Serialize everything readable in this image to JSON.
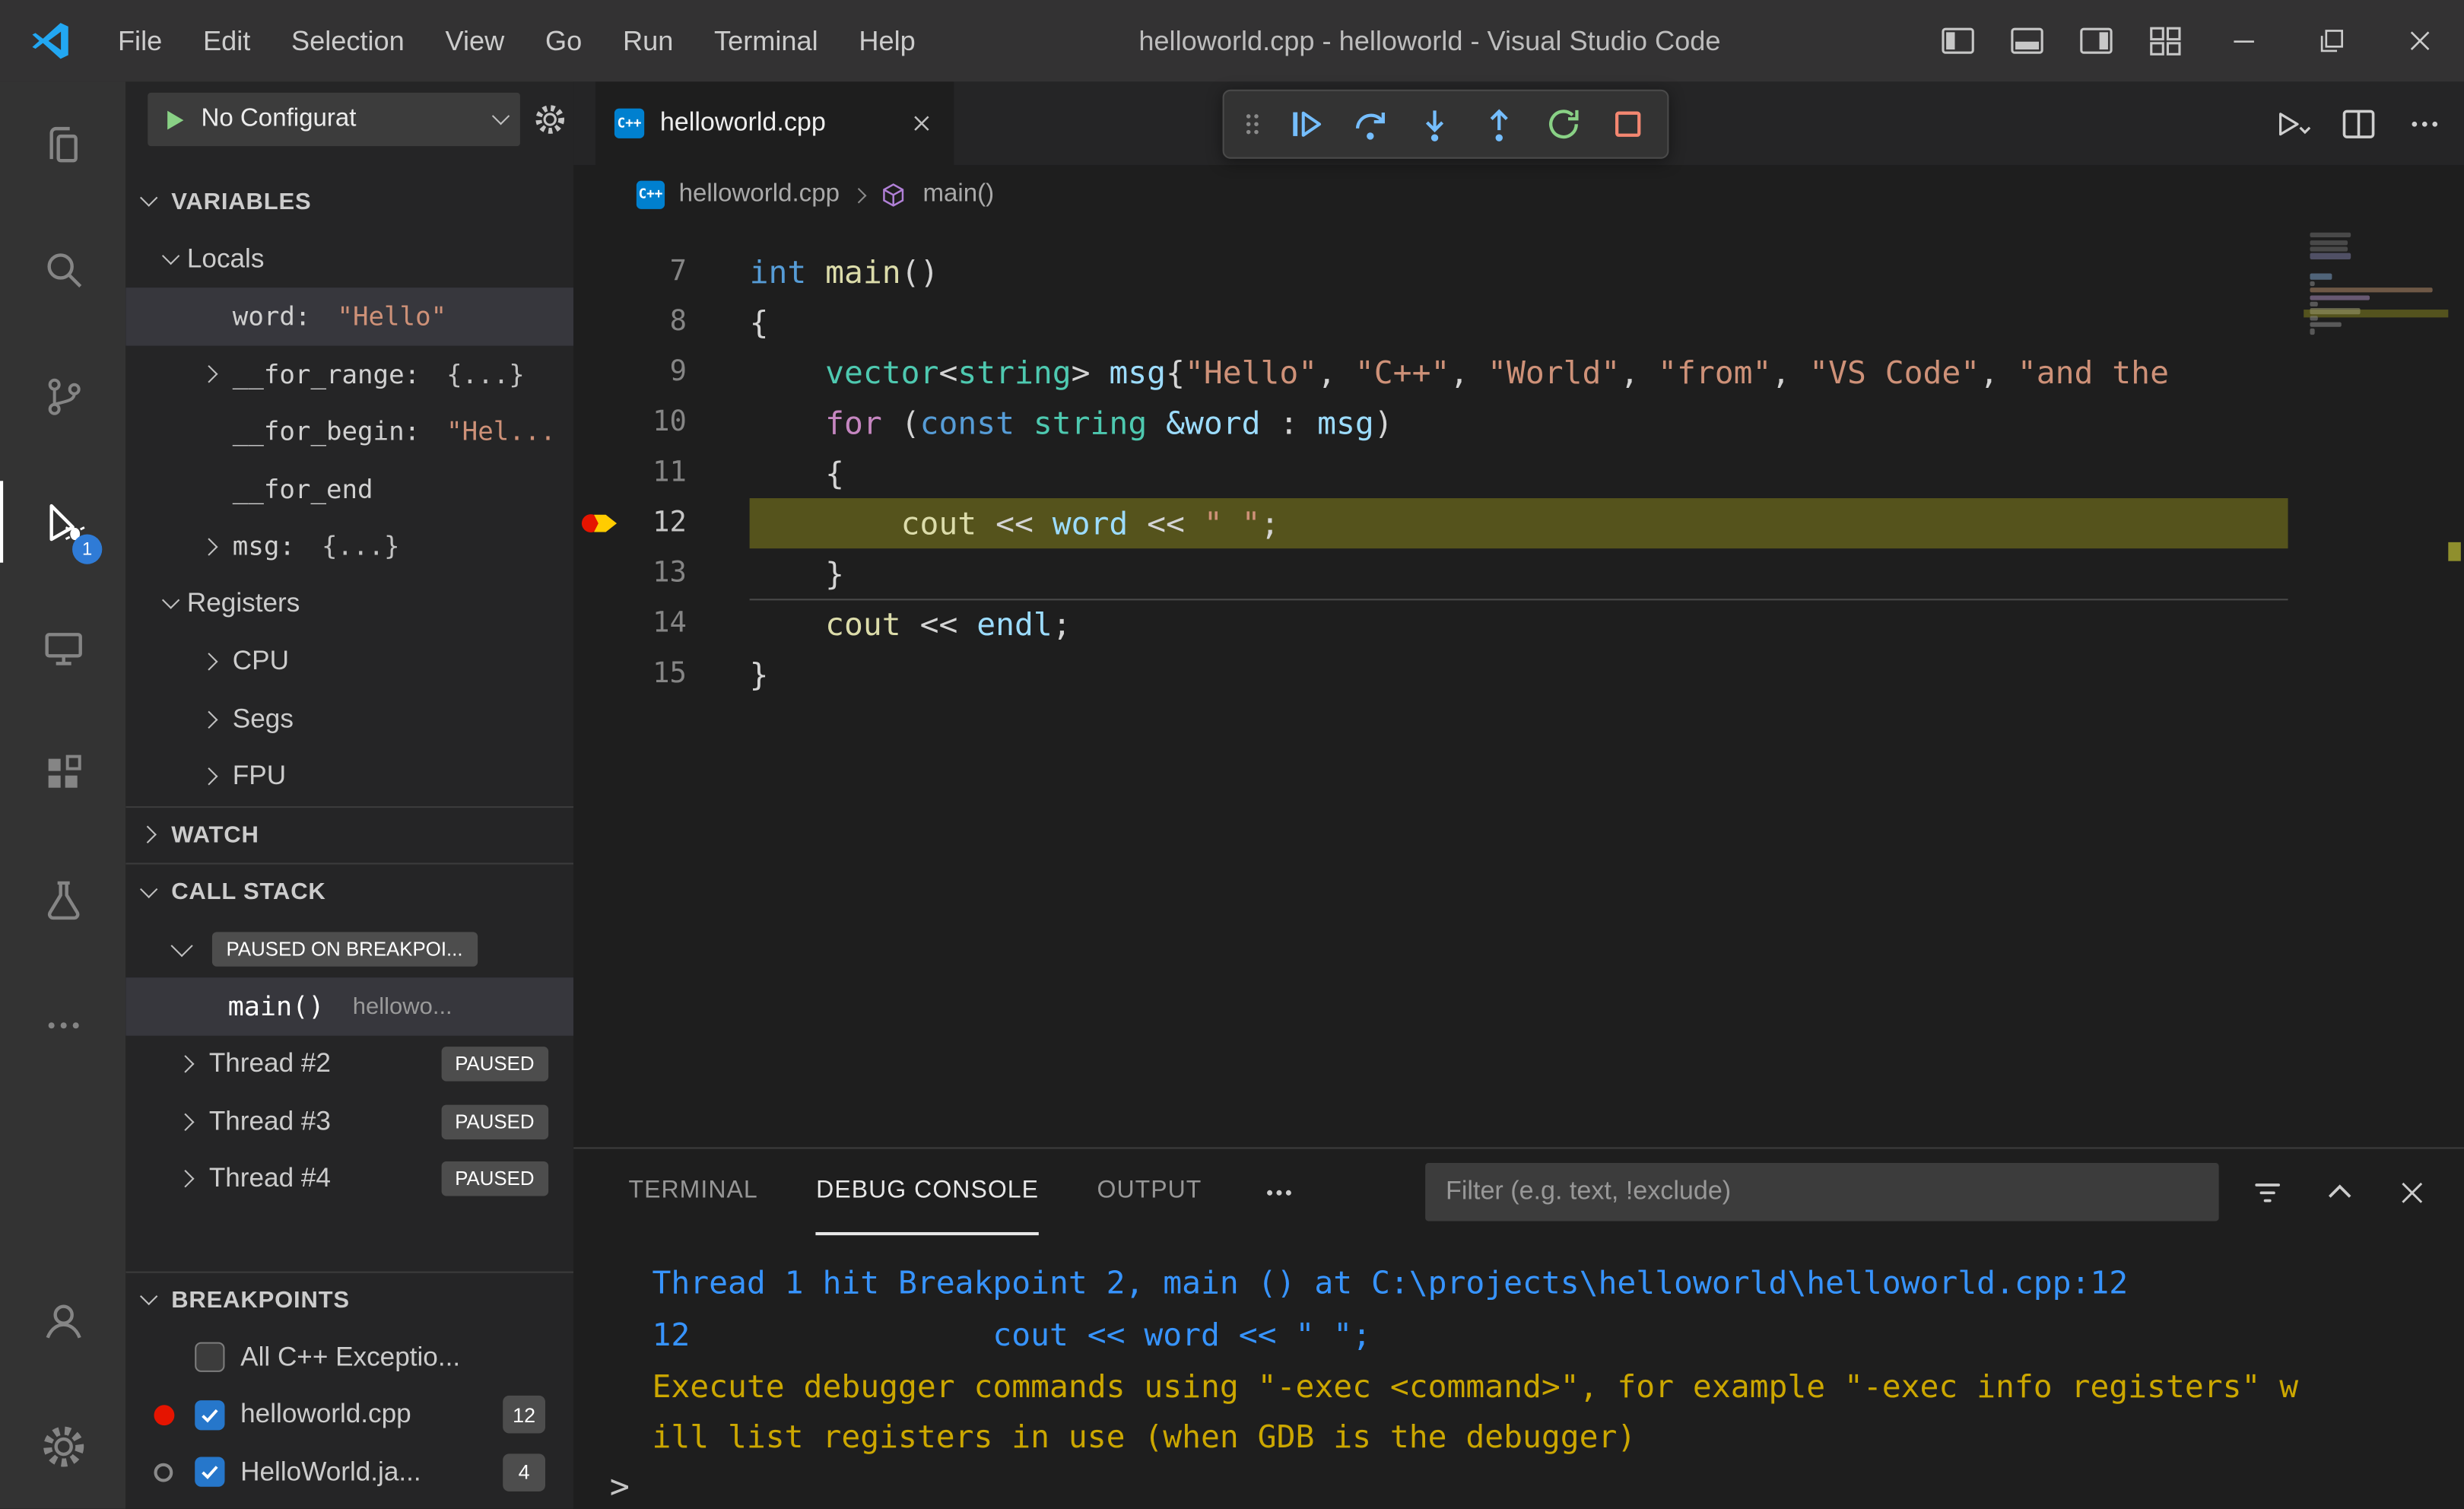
{
  "titlebar": {
    "menus": [
      "File",
      "Edit",
      "Selection",
      "View",
      "Go",
      "Run",
      "Terminal",
      "Help"
    ],
    "title": "helloworld.cpp - helloworld - Visual Studio Code",
    "layout_icons": [
      "layout-sidebar-left",
      "layout-panel",
      "layout-sidebar-right",
      "customize-layout"
    ],
    "window_controls": [
      "minimize",
      "maximize",
      "close"
    ]
  },
  "activitybar": {
    "items": [
      {
        "name": "explorer",
        "icon": "explorer"
      },
      {
        "name": "search",
        "icon": "search"
      },
      {
        "name": "source-control",
        "icon": "scm"
      },
      {
        "name": "run-and-debug",
        "icon": "debug",
        "active": true,
        "badge": "1"
      },
      {
        "name": "remote-explorer",
        "icon": "remote"
      },
      {
        "name": "extensions",
        "icon": "extensions"
      },
      {
        "name": "testing",
        "icon": "testing"
      },
      {
        "name": "more-views",
        "icon": "more"
      }
    ],
    "bottom_items": [
      {
        "name": "account",
        "icon": "account"
      },
      {
        "name": "settings",
        "icon": "gear"
      }
    ]
  },
  "sidebar": {
    "run_toolbar": {
      "config_label": "No Configurat"
    },
    "variables": {
      "header": "VARIABLES",
      "groups": [
        {
          "label": "Locals",
          "items": [
            {
              "name": "word:",
              "value": "\"Hello\"",
              "vtype": "string",
              "chevron": "none",
              "selected": true,
              "mono": true
            },
            {
              "name": "__for_range:",
              "value": "{...}",
              "vtype": "plain",
              "chevron": "right",
              "mono": true
            },
            {
              "name": "__for_begin:",
              "value": "\"Hel...",
              "vtype": "string",
              "chevron": "none",
              "mono": true
            },
            {
              "name": "__for_end",
              "value": "",
              "vtype": "plain",
              "chevron": "none",
              "mono": true
            },
            {
              "name": "msg:",
              "value": "{...}",
              "vtype": "plain",
              "chevron": "right",
              "mono": true
            }
          ]
        },
        {
          "label": "Registers",
          "items": [
            {
              "name": "CPU",
              "value": "",
              "vtype": "plain",
              "chevron": "right",
              "mono": false
            },
            {
              "name": "Segs",
              "value": "",
              "vtype": "plain",
              "chevron": "right",
              "mono": false
            },
            {
              "name": "FPU",
              "value": "",
              "vtype": "plain",
              "chevron": "right",
              "mono": false
            }
          ]
        }
      ]
    },
    "watch": {
      "header": "WATCH"
    },
    "callstack": {
      "header": "CALL STACK",
      "session_status": "PAUSED ON BREAKPOI...",
      "frame": {
        "fn": "main()",
        "file": "hellowo..."
      },
      "threads": [
        {
          "label": "Thread #2",
          "status": "PAUSED"
        },
        {
          "label": "Thread #3",
          "status": "PAUSED"
        },
        {
          "label": "Thread #4",
          "status": "PAUSED"
        }
      ]
    },
    "breakpoints": {
      "header": "BREAKPOINTS",
      "items": [
        {
          "label": "All C++ Exceptio...",
          "checked": false,
          "marker": "none",
          "count": ""
        },
        {
          "label": "helloworld.cpp",
          "checked": true,
          "marker": "red",
          "count": "12"
        },
        {
          "label": "HelloWorld.ja...",
          "checked": true,
          "marker": "gray",
          "count": "4"
        }
      ]
    }
  },
  "editor": {
    "tab": {
      "label": "helloworld.cpp"
    },
    "breadcrumb": {
      "file": "helloworld.cpp",
      "symbol": "main()"
    },
    "debug_toolbar": [
      "continue",
      "step-over",
      "step-into",
      "step-out",
      "restart",
      "stop"
    ],
    "actions": [
      "run-action",
      "split-editor",
      "more"
    ],
    "code": {
      "current_line": "12",
      "lines": [
        {
          "num": "7",
          "tokens": [
            [
              "kw",
              "int"
            ],
            [
              "pl",
              " "
            ],
            [
              "fn",
              "main"
            ],
            [
              "pl",
              "()"
            ]
          ]
        },
        {
          "num": "8",
          "tokens": [
            [
              "pl",
              "{"
            ]
          ]
        },
        {
          "num": "9",
          "tokens": [
            [
              "pl",
              "    "
            ],
            [
              "ty",
              "vector"
            ],
            [
              "pl",
              "<"
            ],
            [
              "ty",
              "string"
            ],
            [
              "pl",
              "> "
            ],
            [
              "va",
              "msg"
            ],
            [
              "pl",
              "{"
            ],
            [
              "st",
              "\"Hello\""
            ],
            [
              "pl",
              ", "
            ],
            [
              "st",
              "\"C++\""
            ],
            [
              "pl",
              ", "
            ],
            [
              "st",
              "\"World\""
            ],
            [
              "pl",
              ", "
            ],
            [
              "st",
              "\"from\""
            ],
            [
              "pl",
              ", "
            ],
            [
              "st",
              "\"VS Code\""
            ],
            [
              "pl",
              ", "
            ],
            [
              "st",
              "\"and the"
            ]
          ]
        },
        {
          "num": "10",
          "tokens": [
            [
              "pl",
              "    "
            ],
            [
              "ct",
              "for"
            ],
            [
              "pl",
              " ("
            ],
            [
              "kw",
              "const"
            ],
            [
              "pl",
              " "
            ],
            [
              "ty",
              "string"
            ],
            [
              "pl",
              " "
            ],
            [
              "va",
              "&word"
            ],
            [
              "pl",
              " : "
            ],
            [
              "va",
              "msg"
            ],
            [
              "pl",
              ")"
            ]
          ]
        },
        {
          "num": "11",
          "tokens": [
            [
              "pl",
              "    {"
            ]
          ]
        },
        {
          "num": "12",
          "tokens": [
            [
              "pl",
              "        "
            ],
            [
              "fn",
              "cout"
            ],
            [
              "pl",
              " << "
            ],
            [
              "va",
              "word"
            ],
            [
              "pl",
              " << "
            ],
            [
              "st",
              "\" \""
            ],
            [
              "pl",
              ";"
            ]
          ]
        },
        {
          "num": "13",
          "tokens": [
            [
              "pl",
              "    }"
            ]
          ]
        },
        {
          "num": "14",
          "tokens": [
            [
              "pl",
              "    "
            ],
            [
              "fn",
              "cout"
            ],
            [
              "pl",
              " << "
            ],
            [
              "va",
              "endl"
            ],
            [
              "pl",
              ";"
            ]
          ]
        },
        {
          "num": "15",
          "tokens": [
            [
              "pl",
              "}"
            ]
          ]
        }
      ]
    }
  },
  "panel": {
    "tabs": [
      {
        "label": "TERMINAL"
      },
      {
        "label": "DEBUG CONSOLE",
        "active": true
      },
      {
        "label": "OUTPUT"
      }
    ],
    "filter_placeholder": "Filter (e.g. text, !exclude)",
    "actions": [
      "filter",
      "chevron-up",
      "close"
    ],
    "console": [
      {
        "color": "blue",
        "text": "Thread 1 hit Breakpoint 2, main () at C:\\projects\\helloworld\\helloworld.cpp:12"
      },
      {
        "color": "blue",
        "text": "12                cout << word << \" \";"
      },
      {
        "color": "yellow",
        "text": "Execute debugger commands using \"-exec <command>\", for example \"-exec info registers\" w"
      },
      {
        "color": "yellow",
        "text": "ill list registers in use (when GDB is the debugger)"
      }
    ],
    "prompt": ">"
  },
  "colors": {
    "accent_blue": "#2f7bd6",
    "debug_blue": "#3794ff",
    "warn_yellow": "#cca700",
    "breakpoint_red": "#e51400",
    "current_line": "#55531c"
  }
}
